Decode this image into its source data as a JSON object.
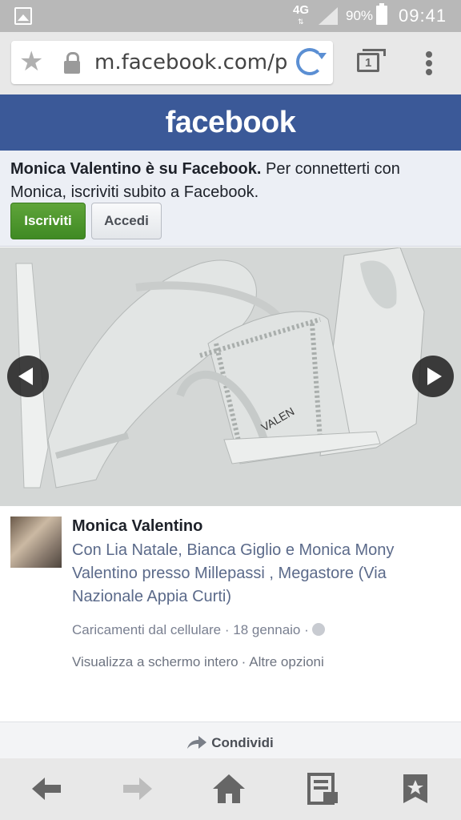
{
  "status_bar": {
    "network": "4G",
    "battery": "90%",
    "time": "09:41",
    "icons": [
      "gallery-icon",
      "signal-icon",
      "battery-icon"
    ]
  },
  "browser": {
    "url": "m.facebook.com/p",
    "tab_count": "1",
    "icons": [
      "star-icon",
      "lock-icon",
      "reload-icon",
      "tabs-icon",
      "menu-icon"
    ]
  },
  "header": {
    "logo": "facebook",
    "color": "#3b5998"
  },
  "signup": {
    "bold_text": "Monica Valentino è su Facebook.",
    "text": " Per connetterti con Monica, iscriviti subito a Facebook.",
    "signup_button": "Iscriviti",
    "login_button": "Accedi",
    "signup_color": "#4c9a2e"
  },
  "photo": {
    "brand_text": "VALEN",
    "icons": [
      "prev-arrow-icon",
      "next-arrow-icon"
    ]
  },
  "post": {
    "author": "Monica Valentino",
    "with_text": "Con Lia Natale, Bianca Giglio e Monica Mony Valentino presso Millepassi , Megastore (Via Nazionale Appia Curti)",
    "meta": "Caricamenti dal cellulare · 18 gennaio ·",
    "fullscreen": "Visualizza a schermo intero",
    "more": "Altre opzioni",
    "separator": "·"
  },
  "share": {
    "label": "Condividi"
  },
  "bottom_nav": {
    "icons": [
      "back-icon",
      "forward-icon",
      "home-icon",
      "reader-icon",
      "bookmark-icon"
    ]
  }
}
